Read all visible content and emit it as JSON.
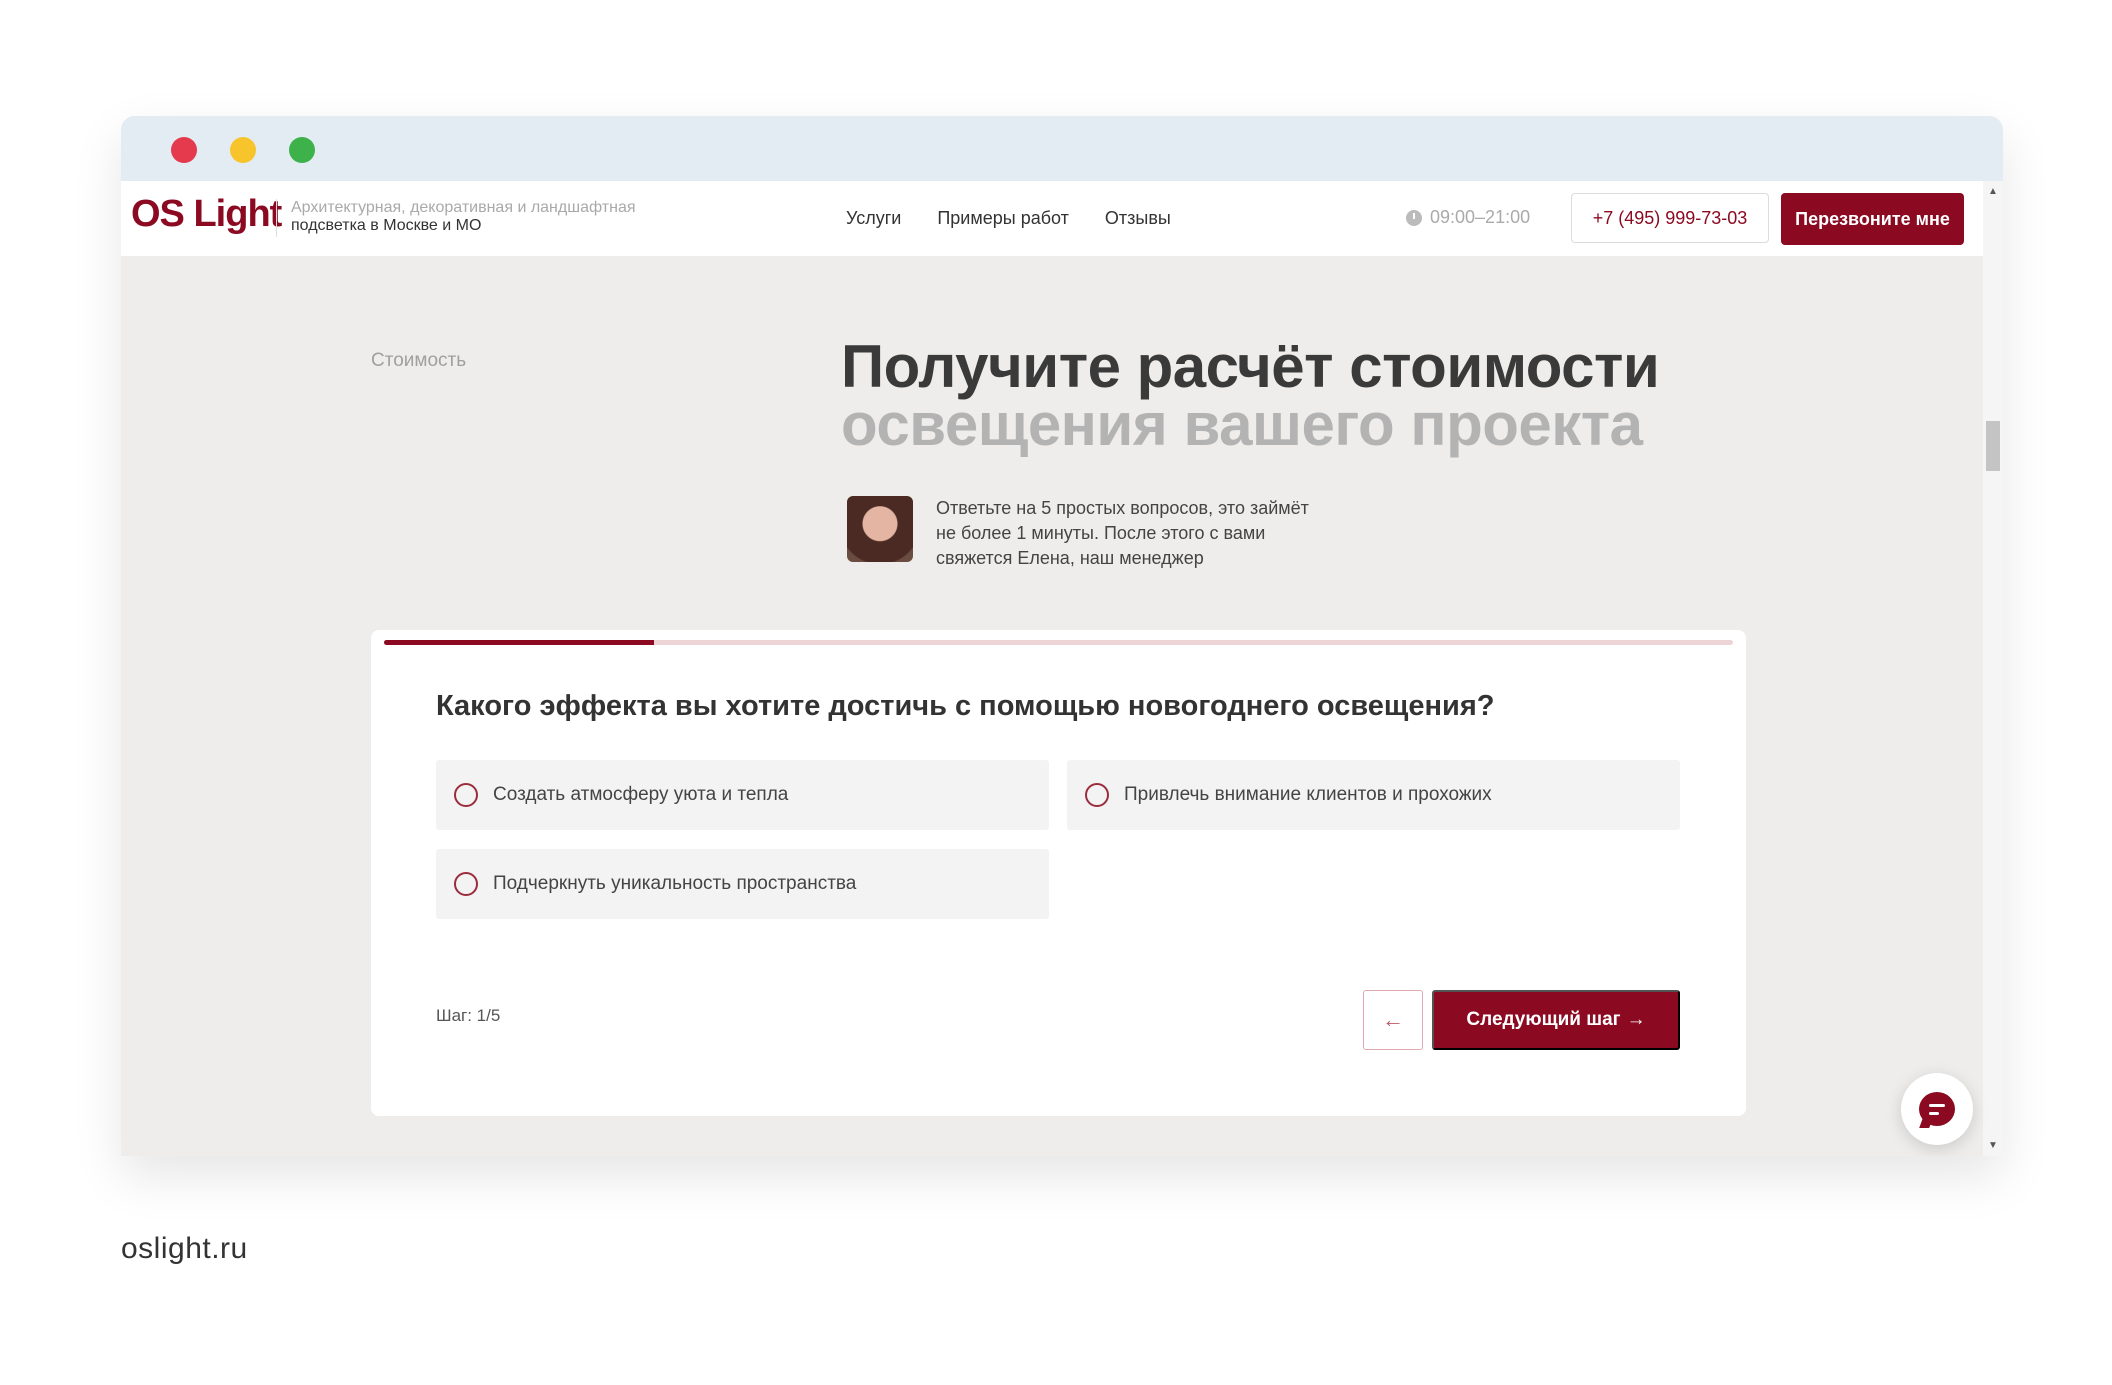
{
  "window": {
    "dots": [
      "red",
      "yellow",
      "green"
    ]
  },
  "header": {
    "logo": "OS Light",
    "tagline_light": "Архитектурная, декоративная и ландшафтная",
    "tagline_dark": "подсветка в Москве и МО",
    "nav": [
      "Услуги",
      "Примеры работ",
      "Отзывы"
    ],
    "hours": "09:00–21:00",
    "phone": "+7 (495) 999-73-03",
    "callback": "Перезвоните мне"
  },
  "main": {
    "section_label": "Стоимость",
    "headline_line1": "Получите расчёт стоимости",
    "headline_line2": "освещения вашего проекта",
    "intro": "Ответьте на 5 простых вопросов, это займёт не более 1 минуты. После этого с вами свяжется Елена, наш менеджер"
  },
  "quiz": {
    "progress_fraction": 0.2,
    "question": "Какого эффекта вы хотите достичь с помощью новогоднего освещения?",
    "options": [
      "Создать атмосферу уюта и тепла",
      "Привлечь внимание клиентов и прохожих",
      "Подчеркнуть уникальность пространства"
    ],
    "step": "Шаг: 1/5",
    "back_icon": "arrow-left-icon",
    "back_glyph": "←",
    "next_label": "Следующий шаг",
    "next_glyph": "→"
  },
  "chat": {
    "icon": "chat-icon"
  },
  "footer": {
    "url": "oslight.ru"
  },
  "colors": {
    "accent": "#8b0a21",
    "progress_track": "#ecd4d7",
    "page_bg": "#eeedeb"
  }
}
